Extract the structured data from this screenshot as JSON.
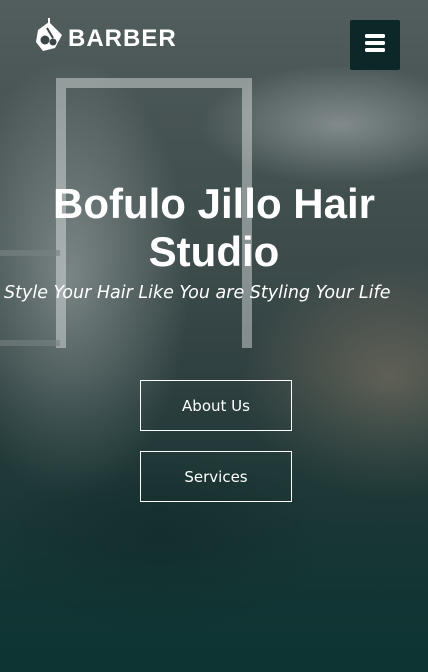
{
  "header": {
    "logo_text": "BARBER",
    "logo_icon": "scissors-comb-icon",
    "menu_icon": "hamburger-icon"
  },
  "hero": {
    "title_line1": "Bofulo Jillo Hair",
    "title_line2": "Studio",
    "tagline": "Style Your Hair Like You are Styling Your Life",
    "about_label": "About Us",
    "services_label": "Services"
  },
  "colors": {
    "menu_button_bg": "#0b2727",
    "overlay_bottom": "#0c3432",
    "text": "#ffffff"
  }
}
